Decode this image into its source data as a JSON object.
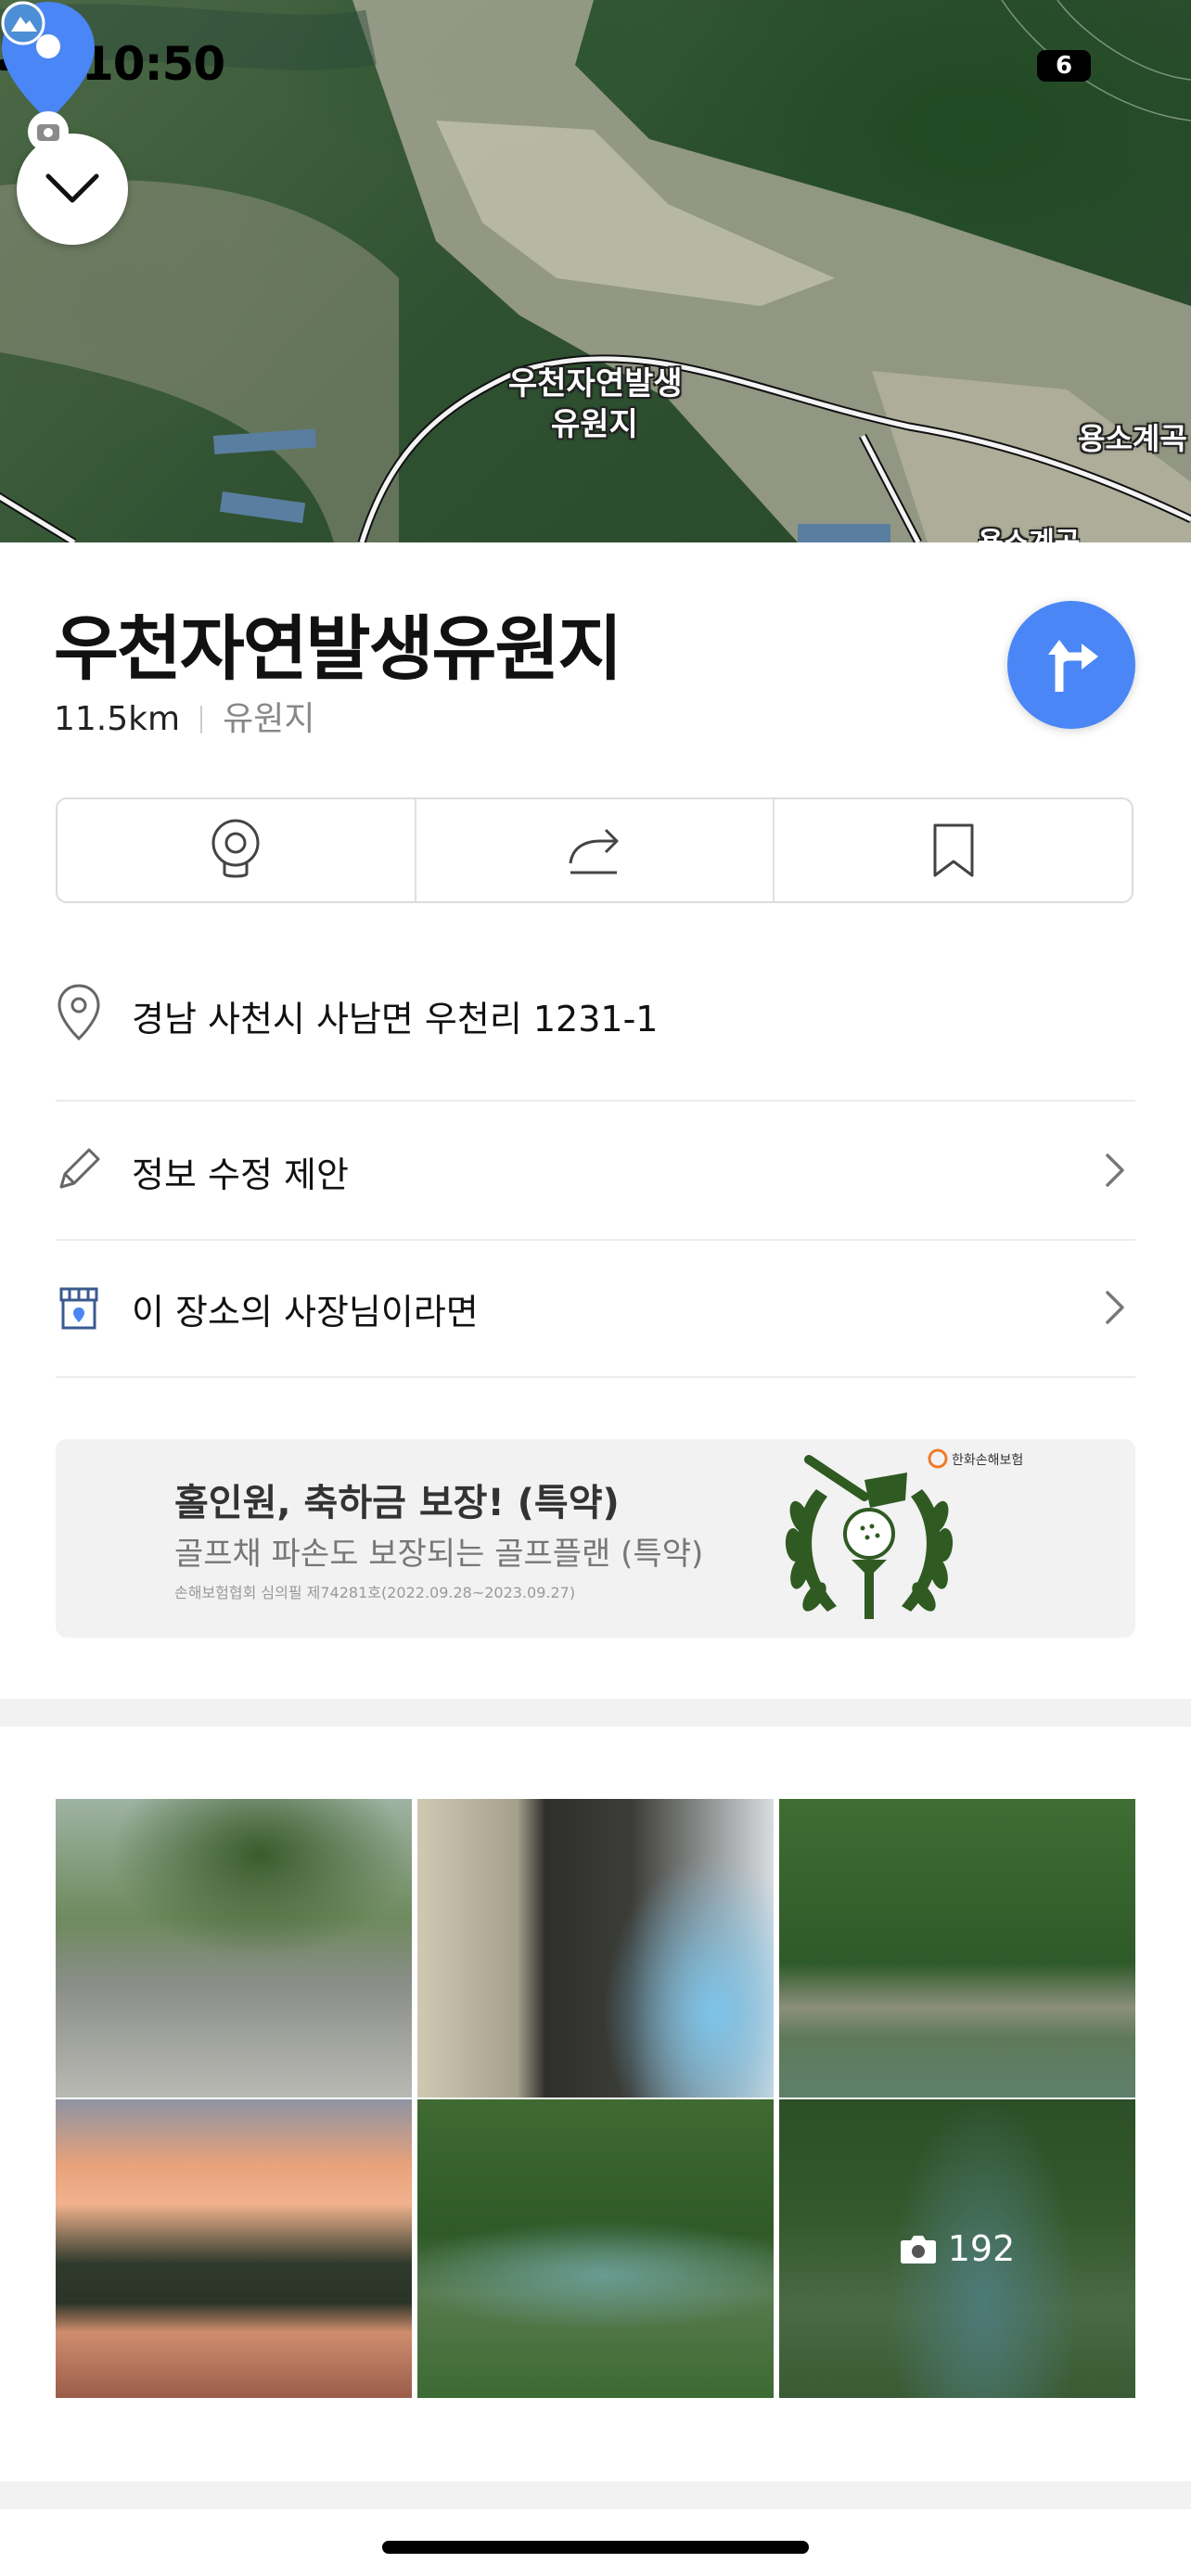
{
  "status_bar": {
    "time": "10:50",
    "battery": "6",
    "icons": [
      "location-arrow-icon",
      "cellular-signal-icon",
      "wifi-icon",
      "battery-icon"
    ]
  },
  "map": {
    "place_label_line1": "우천자연발생",
    "place_label_line2": "유원지",
    "nearby_label": "용소계곡",
    "nearby_label_2": "용소계곡",
    "pin_color": "#4a86f5"
  },
  "place": {
    "name": "우천자연발생유원지",
    "distance": "11.5km",
    "category": "유원지"
  },
  "actions": {
    "icons": [
      "street-view-icon",
      "share-icon",
      "bookmark-icon"
    ]
  },
  "info": {
    "address": "경남 사천시 사남면 우천리 1231-1",
    "edit_suggestion": "정보 수정 제안",
    "owner_prompt": "이 장소의 사장님이라면"
  },
  "ad": {
    "headline": "홀인원, 축하금 보장! (특약)",
    "subline": "골프채 파손도 보장되는 골프플랜 (특약)",
    "fineprint": "손해보험협회 심의필 제74281호(2022.09.28~2023.09.27)",
    "brand": "한화손해보험"
  },
  "photos": {
    "count": "192"
  },
  "colors": {
    "accent": "#4a86f5",
    "divider": "#ececec",
    "muted_text": "#888888"
  }
}
